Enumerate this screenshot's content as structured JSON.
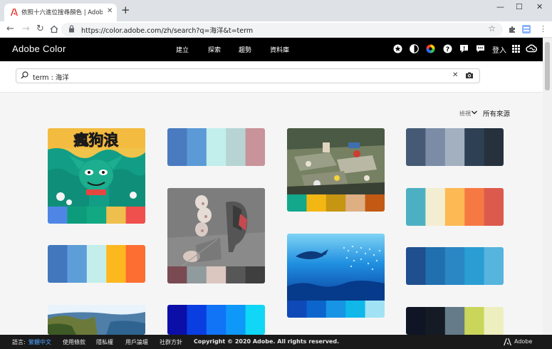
{
  "browser": {
    "tab_title": "依照十六進位搜尋顏色 | Adobe C",
    "tab_close": "✕",
    "new_tab": "+",
    "window_controls": [
      "—",
      "☐",
      "✕"
    ],
    "url": "https://color.adobe.com/zh/search?q=海洋&t=term",
    "icons": [
      "back-arrow-icon",
      "forward-arrow-icon",
      "reload-icon",
      "home-icon",
      "lock-icon",
      "star-icon",
      "extensions-icon",
      "profile-icon",
      "menu-icon"
    ]
  },
  "header": {
    "logo": "Adobe Color",
    "nav": [
      "建立",
      "探索",
      "趨勢",
      "資料庫"
    ],
    "login": "登入",
    "icons": [
      "badge-icon",
      "contrast-icon",
      "color-wheel-icon",
      "help-icon",
      "feedback-icon",
      "chat-icon",
      "apps-grid-icon",
      "creative-cloud-icon"
    ]
  },
  "search": {
    "value": "term : 海洋",
    "clear": "✕"
  },
  "filters": {
    "sort_label": "檢視",
    "source": "所有來源"
  },
  "colors": {
    "accent": "#000000",
    "footer_bg": "#1a1a1a",
    "link": "#4da3ff"
  },
  "palettes": {
    "p_row1_col2": [
      "#4a7abf",
      "#5b9ad6",
      "#c2eeec",
      "#b7d4d2",
      "#c8939a"
    ],
    "p_row1_col4": [
      "#465a75",
      "#7c8ca6",
      "#a3b0c0",
      "#2e4154",
      "#26313d"
    ],
    "p_col1_img1": [
      "#4f86e6",
      "#0c9c7c",
      "#12a882",
      "#eebf4c",
      "#ef4f4d"
    ],
    "p_col3_img1": [
      "#13a78b",
      "#f2b713",
      "#c69512",
      "#deaf82",
      "#c35a13"
    ],
    "p_col2_img2": [
      "#7a4a52",
      "#909b9d",
      "#dbc6c0",
      "#575757",
      "#3f3f3f"
    ],
    "p_row2_col4": [
      "#4db0c2",
      "#f3eed1",
      "#fdb953",
      "#f67944",
      "#dc5a4d"
    ],
    "p_row3_col1": [
      "#4277be",
      "#5d9ed8",
      "#c4eeec",
      "#fdb71f",
      "#fd6e33"
    ],
    "p_col3_img2": [
      "#0f49b8",
      "#0c65cd",
      "#1894e4",
      "#10b8ea",
      "#a1e3f4"
    ],
    "p_row3_col4": [
      "#1f4f8f",
      "#216fae",
      "#2a87c4",
      "#2a9ed3",
      "#56b4dd"
    ],
    "p_row4_col2": [
      "#0c0ea8",
      "#0a3ee1",
      "#1173f5",
      "#0e98f8",
      "#0fd7f5"
    ],
    "p_row4_col4": [
      "#0f1525",
      "#151b25",
      "#657b88",
      "#c9d65a",
      "#eeefbf"
    ]
  },
  "footer": {
    "lang_label": "語言:",
    "lang_value": "繁體中文",
    "links": [
      "使用條款",
      "隱私權",
      "用戶論壇",
      "社群方針"
    ],
    "copyright": "Copyright © 2020 Adobe. All rights reserved.",
    "brand": "Adobe"
  }
}
